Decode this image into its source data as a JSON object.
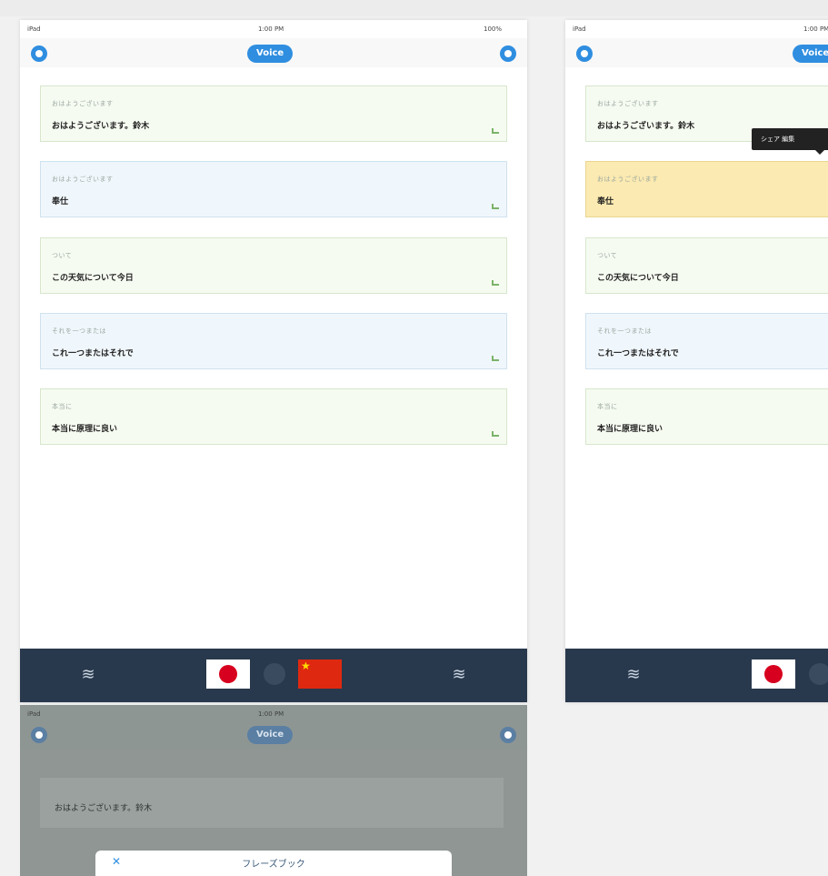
{
  "status": {
    "carrier": "iPad",
    "time": "1:00 PM",
    "battery": "100%"
  },
  "nav": {
    "voice_label": "Voice"
  },
  "phrases": [
    {
      "sub": "おはようございます",
      "main": "おはようございます。鈴木"
    },
    {
      "sub": "おはようございます",
      "main": "奉仕"
    },
    {
      "sub": "ついて",
      "main": "この天気について今日"
    },
    {
      "sub": "それを一つまたは",
      "main": "これ一つまたはそれで"
    },
    {
      "sub": "本当に",
      "main": "本当に原理に良い"
    }
  ],
  "tooltip": {
    "text": "シェア  編集"
  },
  "modal": {
    "title": "フレーズブック",
    "close": "✕"
  },
  "colors": {
    "accent": "#2f8ee0",
    "bar": "#29394d",
    "highlight": "#fbeab1"
  },
  "icons": [
    "gear-icon",
    "info-icon",
    "wifi-icon",
    "japan-flag-icon",
    "china-flag-icon",
    "swap-icon",
    "close-icon"
  ]
}
